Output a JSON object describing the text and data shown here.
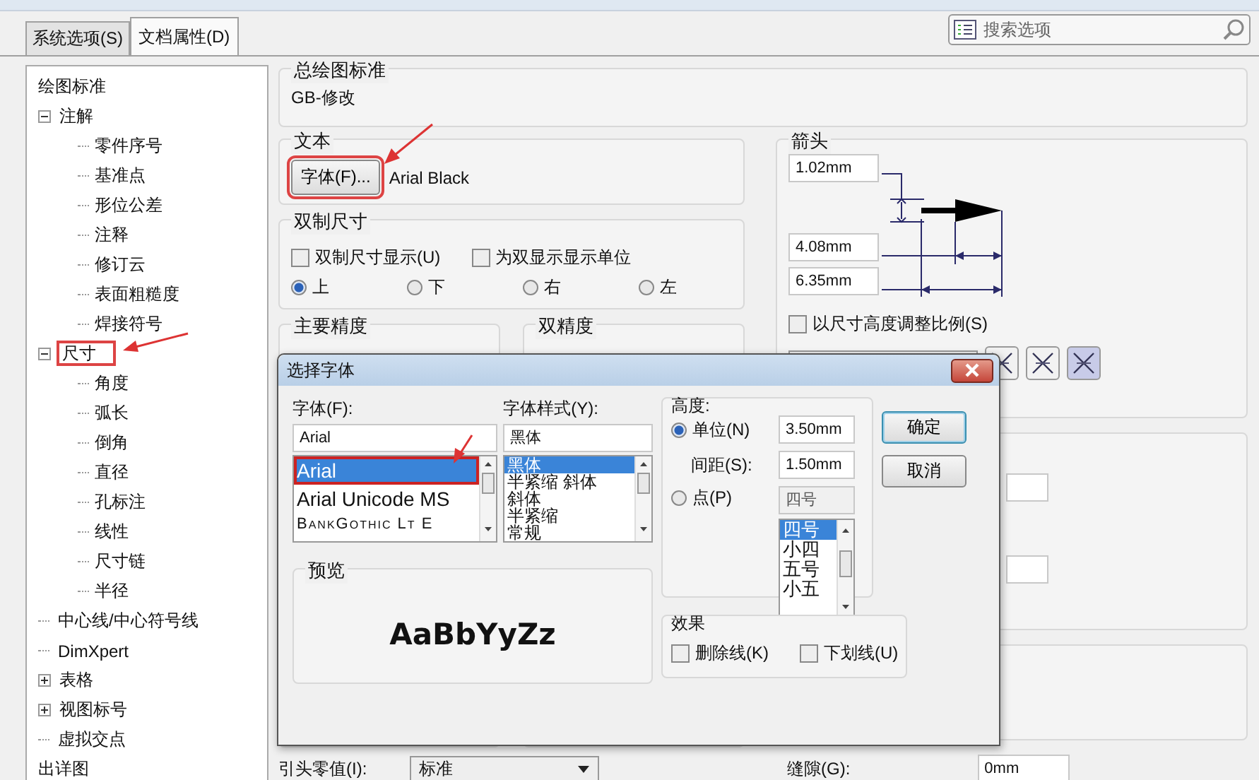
{
  "tabs": [
    {
      "label": "系统选项(S)",
      "selected": false
    },
    {
      "label": "文档属性(D)",
      "selected": true
    }
  ],
  "search": {
    "placeholder": "搜索选项"
  },
  "tree": [
    {
      "label": "绘图标准",
      "kind": "heading"
    },
    {
      "label": "注解",
      "kind": "node",
      "expanded": true,
      "children": [
        {
          "label": "零件序号"
        },
        {
          "label": "基准点"
        },
        {
          "label": "形位公差"
        },
        {
          "label": "注释"
        },
        {
          "label": "修订云"
        },
        {
          "label": "表面粗糙度"
        },
        {
          "label": "焊接符号"
        }
      ]
    },
    {
      "label": "尺寸",
      "kind": "node",
      "expanded": true,
      "highlighted": true,
      "children": [
        {
          "label": "角度"
        },
        {
          "label": "弧长"
        },
        {
          "label": "倒角"
        },
        {
          "label": "直径"
        },
        {
          "label": "孔标注"
        },
        {
          "label": "线性"
        },
        {
          "label": "尺寸链"
        },
        {
          "label": "半径"
        }
      ]
    },
    {
      "label": "中心线/中心符号线",
      "kind": "node"
    },
    {
      "label": "DimXpert",
      "kind": "node"
    },
    {
      "label": "表格",
      "kind": "node",
      "expanded": false
    },
    {
      "label": "视图标号",
      "kind": "node",
      "expanded": false
    },
    {
      "label": "虚拟交点",
      "kind": "node"
    },
    {
      "label": "出详图",
      "kind": "heading"
    }
  ],
  "drawing_standard": {
    "title": "总绘图标准",
    "value": "GB-修改"
  },
  "text_group": {
    "title": "文本",
    "button": {
      "label": "字体(F)...",
      "highlighted": true
    },
    "font_name": "Arial Black"
  },
  "dual_dimension": {
    "title": "双制尺寸",
    "checkboxes": [
      {
        "label": "双制尺寸显示(U)",
        "checked": false
      },
      {
        "label": "为双显示显示单位",
        "checked": false
      }
    ],
    "positions": [
      {
        "label": "上",
        "selected": true
      },
      {
        "label": "下",
        "selected": false
      },
      {
        "label": "右",
        "selected": false
      },
      {
        "label": "左",
        "selected": false
      }
    ]
  },
  "precision_groups": [
    {
      "title": "主要精度"
    },
    {
      "title": "双精度"
    }
  ],
  "leading_zeros": {
    "label": "引头零值(I):",
    "value": "标准"
  },
  "arrows": {
    "title": "箭头",
    "sizes": [
      "1.02mm",
      "4.08mm",
      "6.35mm"
    ],
    "scale_checkbox": {
      "label": "以尺寸高度调整比例(S)",
      "checked": false
    },
    "style_buttons": [
      {
        "selected": false
      },
      {
        "selected": false
      },
      {
        "selected": true
      }
    ]
  },
  "gap": {
    "label": "缝隙(G):",
    "value": "0mm"
  },
  "font_dialog": {
    "title": "选择字体",
    "font": {
      "label": "字体(F):",
      "value": "Arial",
      "items": [
        {
          "label": "Arial",
          "selected": true,
          "highlighted": true
        },
        {
          "label": "Arial Unicode MS",
          "selected": false
        },
        {
          "label": "BankGothic Lt E",
          "selected": false,
          "kind": "smallcaps"
        }
      ]
    },
    "style": {
      "label": "字体样式(Y):",
      "value": "黑体",
      "items": [
        {
          "label": "黑体",
          "selected": true
        },
        {
          "label": "半紧缩 斜体",
          "selected": false
        },
        {
          "label": "斜体",
          "selected": false
        },
        {
          "label": "半紧缩",
          "selected": false
        },
        {
          "label": "常规",
          "selected": false
        }
      ]
    },
    "height": {
      "title": "高度:",
      "unit": {
        "label": "单位(N)",
        "selected": true,
        "value": "3.50mm"
      },
      "spacing": {
        "label": "间距(S):",
        "value": "1.50mm"
      },
      "points": {
        "label": "点(P)",
        "selected": false,
        "value": "四号",
        "items": [
          {
            "label": "四号",
            "selected": true
          },
          {
            "label": "小四",
            "selected": false
          },
          {
            "label": "五号",
            "selected": false
          },
          {
            "label": "小五",
            "selected": false
          }
        ]
      }
    },
    "buttons": [
      "确定",
      "取消"
    ],
    "preview": {
      "title": "预览",
      "sample": "AaBbYyZz"
    },
    "effects": {
      "title": "效果",
      "options": [
        {
          "label": "删除线(K)",
          "checked": false
        },
        {
          "label": "下划线(U)",
          "checked": false
        }
      ]
    }
  }
}
